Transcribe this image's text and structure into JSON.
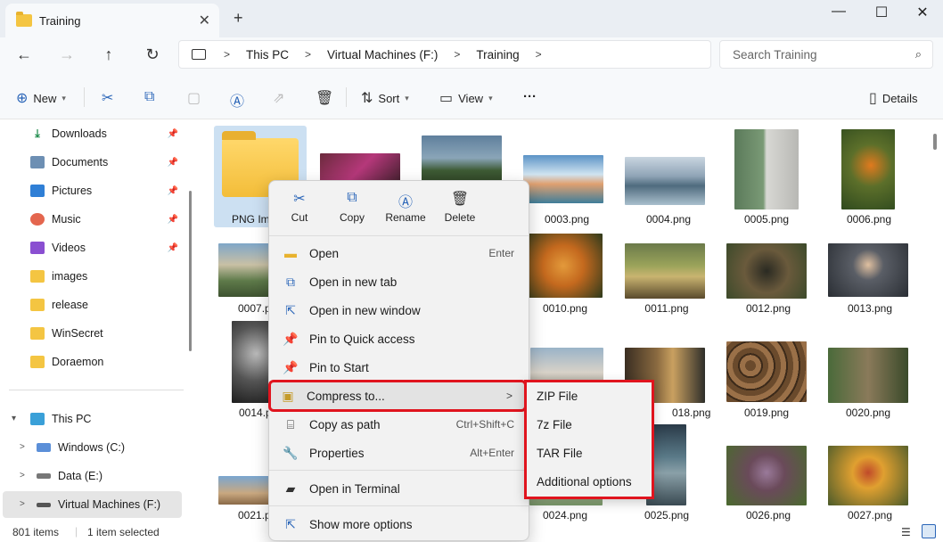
{
  "window": {
    "tab_title": "Training",
    "new_tab": "+",
    "minimize": "—",
    "maximize": "☐",
    "close": "✕"
  },
  "nav": {
    "breadcrumbs": [
      "This PC",
      "Virtual Machines (F:)",
      "Training"
    ],
    "search_placeholder": "Search Training"
  },
  "toolbar": {
    "new_label": "New",
    "sort_label": "Sort",
    "view_label": "View",
    "more_label": "···",
    "details_label": "Details"
  },
  "sidebar": {
    "quick_access": [
      {
        "label": "Downloads",
        "icon": "download-icon"
      },
      {
        "label": "Documents",
        "icon": "document-icon"
      },
      {
        "label": "Pictures",
        "icon": "picture-icon"
      },
      {
        "label": "Music",
        "icon": "music-icon"
      },
      {
        "label": "Videos",
        "icon": "video-icon"
      },
      {
        "label": "images",
        "icon": "folder-icon"
      },
      {
        "label": "release",
        "icon": "folder-icon"
      },
      {
        "label": "WinSecret",
        "icon": "folder-icon"
      },
      {
        "label": "Doraemon",
        "icon": "folder-icon"
      }
    ],
    "this_pc": "This PC",
    "drives": [
      {
        "label": "Windows (C:)"
      },
      {
        "label": "Data (E:)"
      },
      {
        "label": "Virtual Machines (F:)"
      }
    ]
  },
  "files": {
    "folder": "PNG Im",
    "row1": [
      "0003.png",
      "0004.png",
      "0005.png",
      "0006.png"
    ],
    "row2": [
      "0007.p",
      "0010.png",
      "0011.png",
      "0012.png",
      "0013.png"
    ],
    "row3": [
      "0014.p",
      "018.png",
      "0019.png",
      "0020.png"
    ],
    "row4": [
      "0021.p",
      "0024.png",
      "0025.png",
      "0026.png",
      "0027.png"
    ]
  },
  "status": {
    "items": "801 items",
    "selected": "1 item selected"
  },
  "context_menu": {
    "quick_actions": [
      "Cut",
      "Copy",
      "Rename",
      "Delete"
    ],
    "items": [
      {
        "label": "Open",
        "shortcut": "Enter"
      },
      {
        "label": "Open in new tab",
        "shortcut": ""
      },
      {
        "label": "Open in new window",
        "shortcut": ""
      },
      {
        "label": "Pin to Quick access",
        "shortcut": ""
      },
      {
        "label": "Pin to Start",
        "shortcut": ""
      },
      {
        "label": "Compress to...",
        "shortcut": ""
      },
      {
        "label": "Copy as path",
        "shortcut": "Ctrl+Shift+C"
      },
      {
        "label": "Properties",
        "shortcut": "Alt+Enter"
      },
      {
        "label": "Open in Terminal",
        "shortcut": ""
      },
      {
        "label": "Show more options",
        "shortcut": ""
      }
    ],
    "submenu": [
      "ZIP File",
      "7z File",
      "TAR File",
      "Additional options"
    ]
  }
}
